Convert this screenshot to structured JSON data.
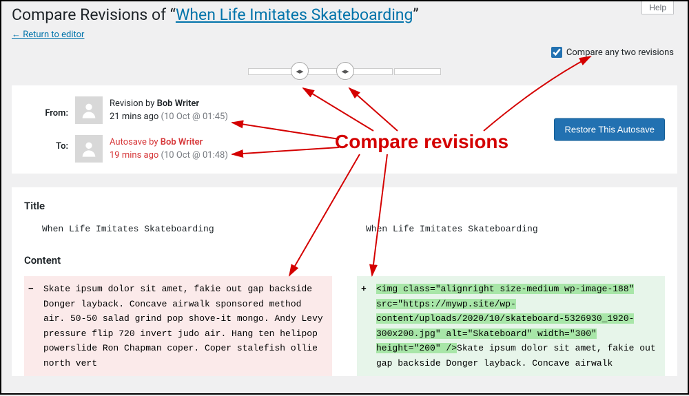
{
  "help_label": "Help",
  "heading_prefix": "Compare Revisions of “",
  "heading_link": "When Life Imitates Skateboarding",
  "heading_suffix": "”",
  "return_link": "← Return to editor",
  "compare_any_label": "Compare any two revisions",
  "compare_any_checked": true,
  "from_label": "From:",
  "to_label": "To:",
  "from_rev": {
    "prefix": "Revision by ",
    "author": "Bob Writer",
    "time": "21 mins ago",
    "paren": "(10 Oct @ 01:45)"
  },
  "to_rev": {
    "prefix": "Autosave by ",
    "author": "Bob Writer",
    "time": "19 mins ago",
    "paren": "(10 Oct @ 01:48)"
  },
  "restore_label": "Restore This Autosave",
  "diff": {
    "title_heading": "Title",
    "title_left": "When Life Imitates Skateboarding",
    "title_right": "When Life Imitates Skateboarding",
    "content_heading": "Content",
    "left_text": "Skate ipsum dolor sit amet, fakie out gap backside Donger layback. Concave airwalk sponsored method air. 50-50 salad grind pop shove-it mongo. Andy Levy pressure flip 720 invert judo air. Hang ten helipop powerslide Ron Chapman coper. Coper stalefish ollie north vert",
    "right_hl": "<img class=\"alignright size-medium wp-image-188\" src=\"https://mywp.site/wp-content/uploads/2020/10/skateboard-5326930_1920-300x200.jpg\" alt=\"Skateboard\" width=\"300\" height=\"200\" />",
    "right_rest": "Skate ipsum dolor sit amet, fakie out gap backside Donger layback. Concave airwalk"
  },
  "annotation": "Compare revisions"
}
